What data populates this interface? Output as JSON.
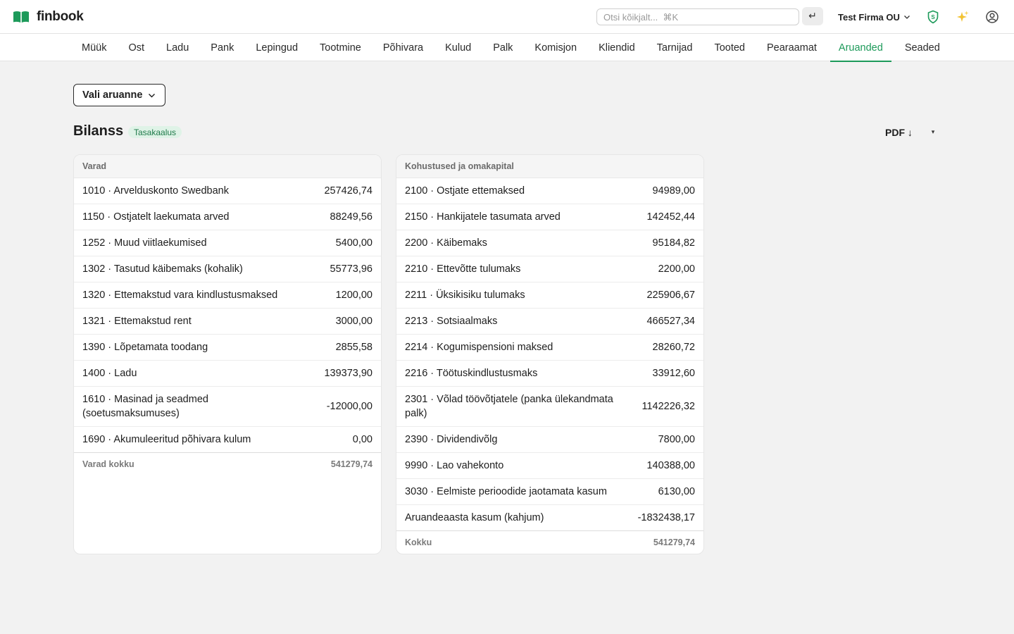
{
  "app": {
    "name": "finbook",
    "brand_color": "#1d9a5a"
  },
  "topbar": {
    "search_placeholder": "Otsi kõikjalt...  ⌘K",
    "enter_symbol": "↵",
    "company_name": "Test Firma OU",
    "icons": [
      "shield-icon",
      "sparkle-icon",
      "user-icon"
    ]
  },
  "nav": {
    "tabs": [
      {
        "label": "Müük"
      },
      {
        "label": "Ost"
      },
      {
        "label": "Ladu"
      },
      {
        "label": "Pank"
      },
      {
        "label": "Lepingud"
      },
      {
        "label": "Tootmine"
      },
      {
        "label": "Põhivara"
      },
      {
        "label": "Kulud"
      },
      {
        "label": "Palk"
      },
      {
        "label": "Komisjon"
      },
      {
        "label": "Kliendid"
      },
      {
        "label": "Tarnijad"
      },
      {
        "label": "Tooted"
      },
      {
        "label": "Pearaamat"
      },
      {
        "label": "Aruanded",
        "active": true
      },
      {
        "label": "Seaded"
      }
    ]
  },
  "report": {
    "select_label": "Vali aruanne",
    "title": "Bilanss",
    "status_badge": "Tasakaalus",
    "pdf_label": "PDF ↓",
    "pdf_dropdown": "▾"
  },
  "assets": {
    "header": "Varad",
    "rows": [
      {
        "label": "1010 · Arvelduskonto Swedbank",
        "amount": "257426,74"
      },
      {
        "label": "1150 · Ostjatelt laekumata arved",
        "amount": "88249,56"
      },
      {
        "label": "1252 · Muud viitlaekumised",
        "amount": "5400,00"
      },
      {
        "label": "1302 · Tasutud käibemaks (kohalik)",
        "amount": "55773,96"
      },
      {
        "label": "1320 · Ettemakstud vara kindlustusmaksed",
        "amount": "1200,00"
      },
      {
        "label": "1321 · Ettemakstud rent",
        "amount": "3000,00"
      },
      {
        "label": "1390 · Lõpetamata toodang",
        "amount": "2855,58"
      },
      {
        "label": "1400 · Ladu",
        "amount": "139373,90"
      },
      {
        "label": "1610 · Masinad ja seadmed (soetusmaksumuses)",
        "amount": "-12000,00"
      },
      {
        "label": "1690 · Akumuleeritud põhivara kulum",
        "amount": "0,00"
      }
    ],
    "total_label": "Varad kokku",
    "total_amount": "541279,74"
  },
  "liabilities": {
    "header": "Kohustused ja omakapital",
    "rows": [
      {
        "label": "2100 · Ostjate ettemaksed",
        "amount": "94989,00"
      },
      {
        "label": "2150 · Hankijatele tasumata arved",
        "amount": "142452,44"
      },
      {
        "label": "2200 · Käibemaks",
        "amount": "95184,82"
      },
      {
        "label": "2210 · Ettevõtte tulumaks",
        "amount": "2200,00"
      },
      {
        "label": "2211 · Üksikisiku tulumaks",
        "amount": "225906,67"
      },
      {
        "label": "2213 · Sotsiaalmaks",
        "amount": "466527,34"
      },
      {
        "label": "2214 · Kogumispensioni maksed",
        "amount": "28260,72"
      },
      {
        "label": "2216 · Töötuskindlustusmaks",
        "amount": "33912,60"
      },
      {
        "label": "2301 · Võlad töövõtjatele (panka ülekandmata palk)",
        "amount": "1142226,32"
      },
      {
        "label": "2390 · Dividendivõlg",
        "amount": "7800,00"
      },
      {
        "label": "9990 · Lao vahekonto",
        "amount": "140388,00"
      },
      {
        "label": "3030 · Eelmiste perioodide jaotamata kasum",
        "amount": "6130,00"
      },
      {
        "label": "Aruandeaasta kasum (kahjum)",
        "amount": "-1832438,17"
      }
    ],
    "total_label": "Kokku",
    "total_amount": "541279,74"
  }
}
